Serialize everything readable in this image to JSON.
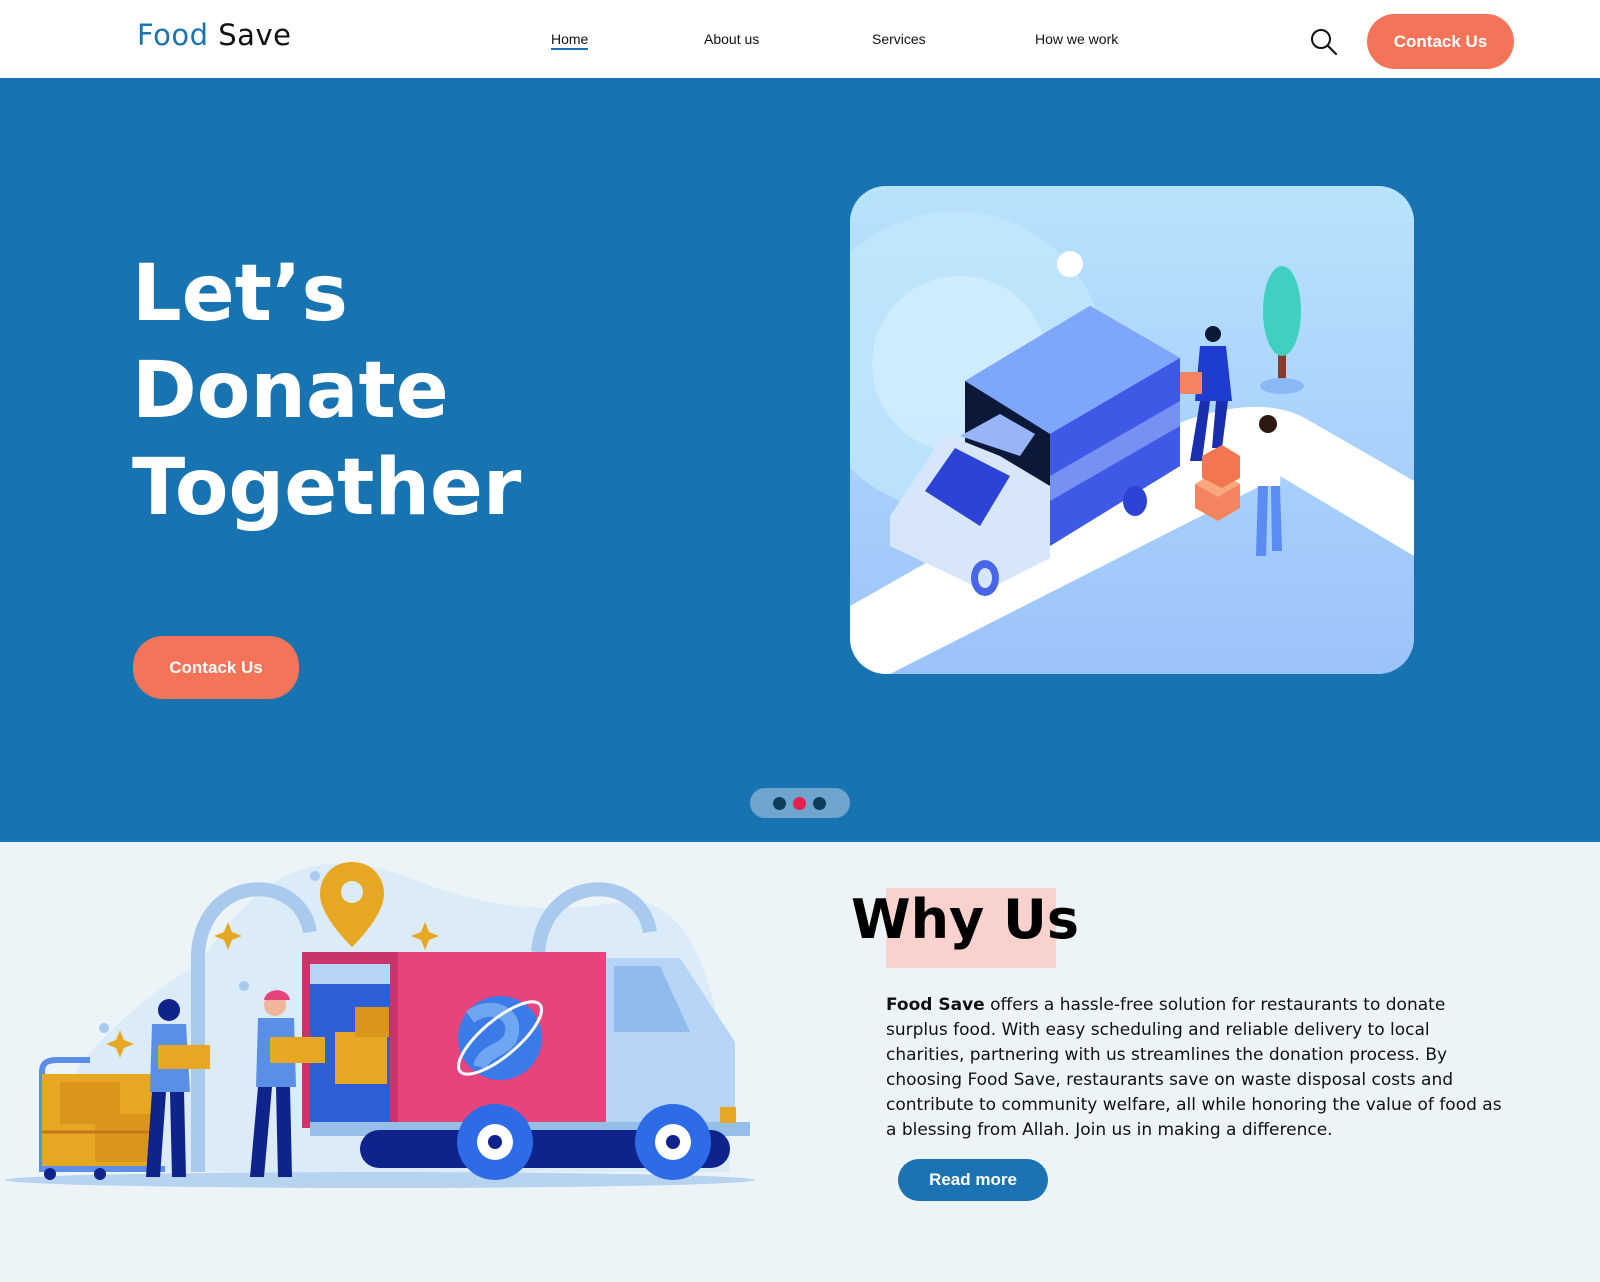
{
  "header": {
    "logo_part1": "Food",
    "logo_part2": "Save",
    "nav": [
      "Home",
      "About us",
      "Services",
      "How we work"
    ],
    "contact_label": "Contack Us"
  },
  "hero": {
    "title_lines": [
      "Let’s",
      "Donate",
      "Together"
    ],
    "cta_label": "Contack Us",
    "carousel_dots": 3,
    "active_dot": 2
  },
  "why": {
    "title": "Why Us",
    "brand": "Food Save",
    "body": " offers a hassle-free solution for restaurants to donate surplus food. With easy scheduling and reliable delivery to local charities, partnering with us streamlines the donation process. By choosing Food Save, restaurants save on waste disposal costs and contribute to community welfare, all while honoring the value of food as a blessing from Allah. Join us in making a difference.",
    "read_more": "Read more"
  },
  "colors": {
    "brand_blue": "#1b73b4",
    "hero_bg": "#1873b1",
    "accent_orange": "#f47459",
    "highlight": "#f9d2cd",
    "active_dot": "#e8204e"
  },
  "icons": [
    "search-icon"
  ]
}
